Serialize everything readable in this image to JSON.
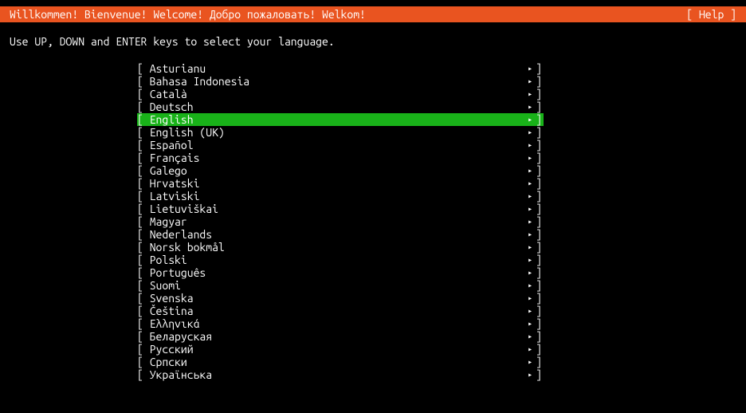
{
  "header": {
    "title": "Willkommen! Bienvenue! Welcome! Добро пожаловать! Welkom!",
    "help": "[ Help ]"
  },
  "instruction": "Use UP, DOWN and ENTER keys to select your language.",
  "selected_index": 4,
  "languages": [
    {
      "label": "Asturianu"
    },
    {
      "label": "Bahasa Indonesia"
    },
    {
      "label": "Català"
    },
    {
      "label": "Deutsch"
    },
    {
      "label": "English"
    },
    {
      "label": "English (UK)"
    },
    {
      "label": "Español"
    },
    {
      "label": "Français"
    },
    {
      "label": "Galego"
    },
    {
      "label": "Hrvatski"
    },
    {
      "label": "Latviski"
    },
    {
      "label": "Lietuviškai"
    },
    {
      "label": "Magyar"
    },
    {
      "label": "Nederlands"
    },
    {
      "label": "Norsk bokmål"
    },
    {
      "label": "Polski"
    },
    {
      "label": "Português"
    },
    {
      "label": "Suomi"
    },
    {
      "label": "Svenska"
    },
    {
      "label": "Čeština"
    },
    {
      "label": "Ελληνικά"
    },
    {
      "label": "Беларуская"
    },
    {
      "label": "Русский"
    },
    {
      "label": "Српски"
    },
    {
      "label": "Українська"
    }
  ],
  "glyphs": {
    "bracket_left": "[ ",
    "bracket_right": "]",
    "arrow": "▸"
  }
}
